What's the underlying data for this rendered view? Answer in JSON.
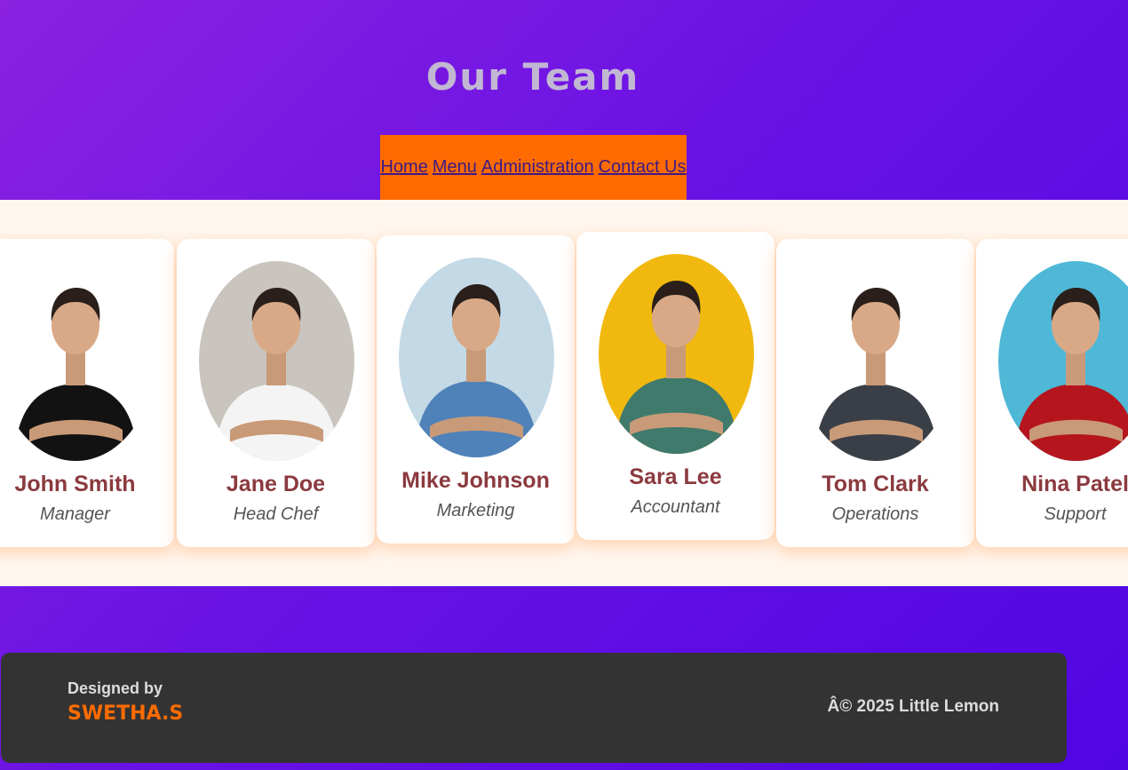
{
  "header": {
    "title": "Our Team"
  },
  "nav": {
    "items": [
      "Home",
      "Menu",
      "Administration",
      "Contact Us"
    ]
  },
  "team": [
    {
      "name": "John Smith",
      "role": "Manager",
      "photo_bg": "#ffffff",
      "shirt": "#121212"
    },
    {
      "name": "Jane Doe",
      "role": "Head Chef",
      "photo_bg": "#c9c4bd",
      "shirt": "#f4f4f4"
    },
    {
      "name": "Mike Johnson",
      "role": "Marketing",
      "photo_bg": "#c4d9e6",
      "shirt": "#4f82b8"
    },
    {
      "name": "Sara Lee",
      "role": "Accountant",
      "photo_bg": "#f1b90f",
      "shirt": "#3f7a6c"
    },
    {
      "name": "Tom Clark",
      "role": "Operations",
      "photo_bg": "#ffffff",
      "shirt": "#3a3f47"
    },
    {
      "name": "Nina Patel",
      "role": "Support",
      "photo_bg": "#4fb8d7",
      "shirt": "#b5161e"
    }
  ],
  "footer": {
    "designed_by_label": "Designed by",
    "designer": "SWETHA.S",
    "copyright": "Â© 2025 Little Lemon"
  },
  "colors": {
    "accent": "#ff6b00",
    "name": "#8b3a3f",
    "footer_bg": "#333333",
    "band_bg": "#fff7ef"
  }
}
